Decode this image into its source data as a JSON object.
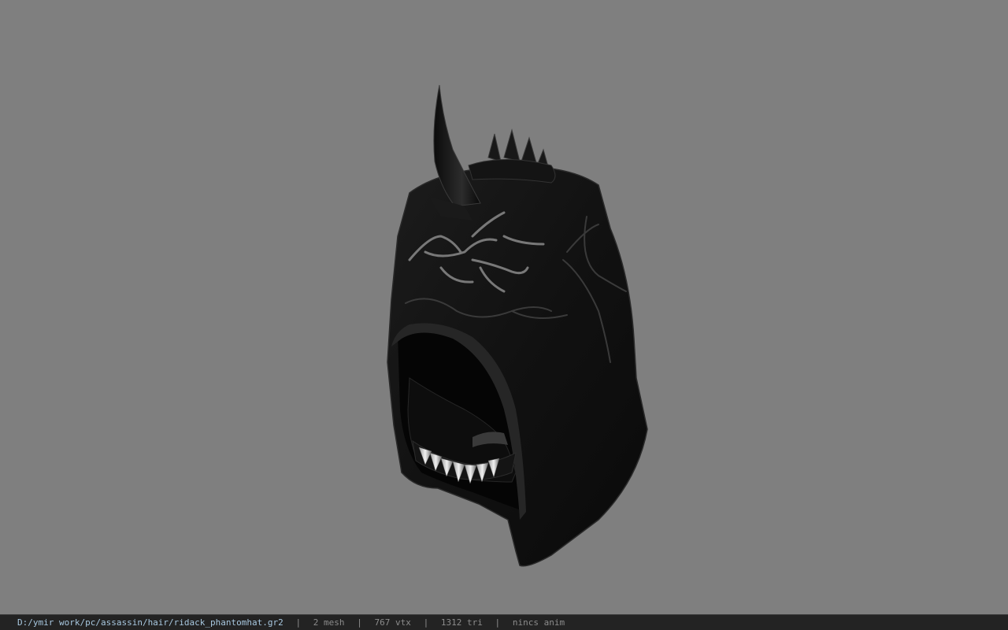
{
  "viewport": {
    "background_color": "#7f7f7f",
    "model_icon": "hooded-mask-helmet"
  },
  "statusbar": {
    "file_path": "D:/ymir work/pc/assassin/hair/ridack_phantomhat.gr2",
    "separator": "|",
    "mesh_count": "2 mesh",
    "vertex_count": "767 vtx",
    "triangle_count": "1312 tri",
    "animation": "nincs anim"
  }
}
